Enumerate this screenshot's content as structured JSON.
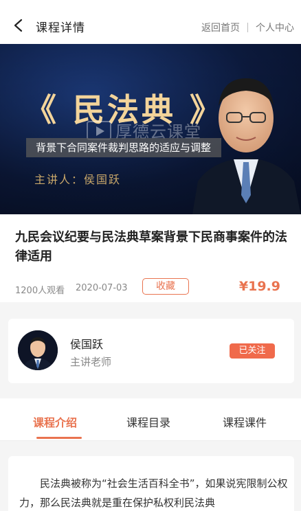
{
  "header": {
    "title": "课程详情",
    "home_link": "返回首页",
    "profile_link": "个人中心"
  },
  "banner": {
    "title": "《 民法典 》",
    "watermark": "厚德云课堂",
    "subtitle": "背景下合同案件裁判思路的适应与调整",
    "lecturer": "主讲人：侯国跃"
  },
  "course": {
    "title": "九民会议纪要与民法典草案背景下民商事案件的法律适用",
    "views": "1200人观看",
    "date": "2020-07-03",
    "collect_label": "收藏",
    "price": "¥19.9"
  },
  "teacher": {
    "name": "侯国跃",
    "role": "主讲老师",
    "follow_label": "已关注"
  },
  "tabs": [
    {
      "label": "课程介绍",
      "active": true
    },
    {
      "label": "课程目录",
      "active": false
    },
    {
      "label": "课程课件",
      "active": false
    }
  ],
  "content": {
    "text": "民法典被称为“社会生活百科全书”，如果说宪限制公权力，那么民法典就是重在保护私权利民法典"
  },
  "colors": {
    "accent": "#e9734f",
    "follow_bg": "#f06a4b",
    "banner_gold": "#f3d49a"
  }
}
